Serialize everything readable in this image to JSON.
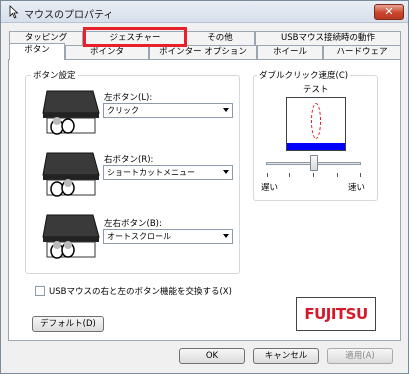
{
  "window": {
    "title": "マウスのプロパティ",
    "close_label": "✕"
  },
  "tabs_row1": [
    {
      "label": "タッピング"
    },
    {
      "label": "ジェスチャー"
    },
    {
      "label": "その他"
    },
    {
      "label": "USBマウス接続時の動作"
    }
  ],
  "tabs_row2": [
    {
      "label": "ボタン"
    },
    {
      "label": "ポインタ"
    },
    {
      "label": "ポインター オプション"
    },
    {
      "label": "ホイール"
    },
    {
      "label": "ハードウェア"
    }
  ],
  "button_settings": {
    "group_label": "ボタン設定",
    "left": {
      "label": "左ボタン(L):",
      "value": "クリック"
    },
    "right": {
      "label": "右ボタン(R):",
      "value": "ショートカットメニュー"
    },
    "both": {
      "label": "左右ボタン(B):",
      "value": "オートスクロール"
    }
  },
  "double_click": {
    "group_label": "ダブルクリック速度(C)",
    "test_label": "テスト",
    "slow_label": "遅い",
    "fast_label": "速い",
    "slider_level": 0.5
  },
  "swap_checkbox": {
    "label": "USBマウスの右と左のボタン機能を交換する(X)",
    "checked": false
  },
  "default_button": "デフォルト(D)",
  "logo_text": "FUJITSU",
  "footer": {
    "ok": "OK",
    "cancel": "キャンセル",
    "apply": "適用(A)"
  },
  "colors": {
    "highlight": "#e8202a",
    "logo": "#d7182a",
    "test_bar": "#0000ff"
  }
}
